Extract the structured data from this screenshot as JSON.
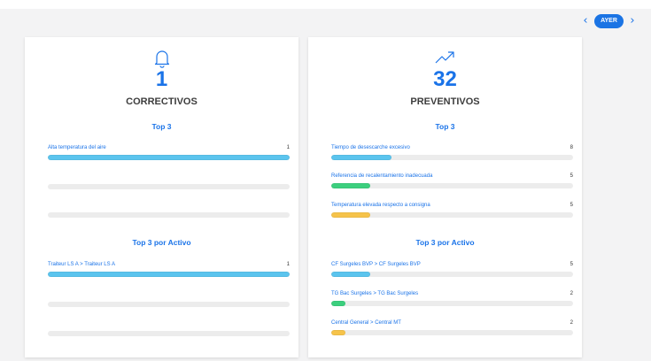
{
  "nav": {
    "prev_icon": "chevron-left-icon",
    "day_button_label": "AYER",
    "next_icon": "chevron-right-icon"
  },
  "colors": {
    "accent": "#1a73e8",
    "bar_blue": "#5bc4ee",
    "bar_green": "#3ccf7e",
    "bar_yellow": "#f6c34a",
    "track": "#ececec"
  },
  "correctivos": {
    "icon": "bell-icon",
    "count": "1",
    "title": "CORRECTIVOS",
    "top3_heading": "Top 3",
    "top3": [
      {
        "label": "Alta temperatura del aire",
        "value": "1",
        "fill": 1.0,
        "color": "#5bc4ee"
      }
    ],
    "top_active_heading": "Top 3 por Activo",
    "top_active": [
      {
        "label": "Traiteur LS A > Traiteur LS A",
        "value": "1",
        "fill": 1.0,
        "color": "#5bc4ee"
      }
    ]
  },
  "preventivos": {
    "icon": "trending-up-icon",
    "count": "32",
    "title": "PREVENTIVOS",
    "top3_heading": "Top 3",
    "top3": [
      {
        "label": "Tiempo de desescarche excesivo",
        "value": "8",
        "fill": 0.25,
        "color": "#5bc4ee"
      },
      {
        "label": "Referencia de recalentamiento inadecuada",
        "value": "5",
        "fill": 0.16,
        "color": "#3ccf7e"
      },
      {
        "label": "Temperatura elevada respecto a consigna",
        "value": "5",
        "fill": 0.16,
        "color": "#f6c34a"
      }
    ],
    "top_active_heading": "Top 3 por Activo",
    "top_active": [
      {
        "label": "CF Surgeles BVP > CF Surgeles BVP",
        "value": "5",
        "fill": 0.16,
        "color": "#5bc4ee"
      },
      {
        "label": "TG Bac Surgeles > TG Bac Surgeles",
        "value": "2",
        "fill": 0.06,
        "color": "#3ccf7e"
      },
      {
        "label": "Central General > Central MT",
        "value": "2",
        "fill": 0.06,
        "color": "#f6c34a"
      }
    ]
  }
}
